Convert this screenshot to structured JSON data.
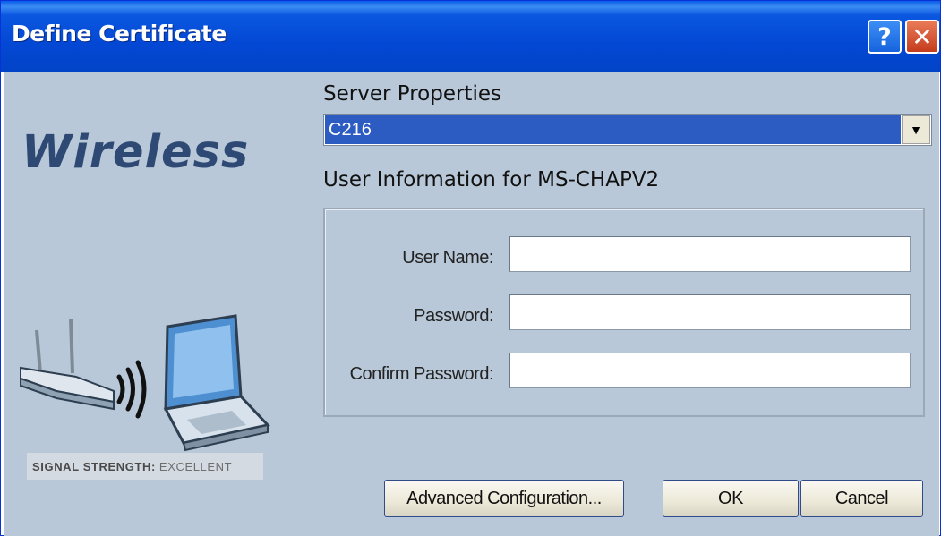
{
  "window": {
    "title": "Define Certificate",
    "help_glyph": "?",
    "close_glyph": "✕"
  },
  "branding": {
    "product": "Wireless",
    "signal_label": "SIGNAL STRENGTH:",
    "signal_value": "EXCELLENT"
  },
  "server": {
    "heading": "Server Properties",
    "selected": "C216"
  },
  "user_info": {
    "heading": "User Information for MS-CHAPV2",
    "fields": [
      {
        "label": "User Name:",
        "value": ""
      },
      {
        "label": "Password:",
        "value": ""
      },
      {
        "label": "Confirm Password:",
        "value": ""
      }
    ]
  },
  "buttons": {
    "advanced": "Advanced Configuration...",
    "ok": "OK",
    "cancel": "Cancel"
  },
  "colors": {
    "titlebar": "#0348d4",
    "client_bg": "#b8c8d8",
    "selection": "#2c5bc2",
    "brand_text": "#2e4a74"
  }
}
